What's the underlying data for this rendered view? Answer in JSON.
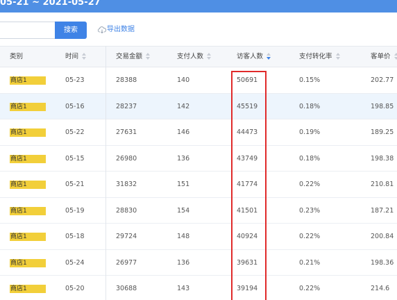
{
  "header": {
    "date_range": "05-21 ~ 2021-05-27"
  },
  "toolbar": {
    "search_value": "",
    "search_label": "搜索",
    "export_label": "导出数据"
  },
  "table": {
    "columns": [
      "类别",
      "时间",
      "交易金额",
      "支付人数",
      "访客人数",
      "支付转化率",
      "客单价"
    ],
    "sorted_column": "访客人数",
    "rows": [
      {
        "category": "商店1",
        "date": "05-23",
        "amount": "28388",
        "payers": "140",
        "visitors": "50691",
        "rate": "0.15%",
        "avg": "202.77"
      },
      {
        "category": "商店1",
        "date": "05-16",
        "amount": "28237",
        "payers": "142",
        "visitors": "45519",
        "rate": "0.18%",
        "avg": "198.85"
      },
      {
        "category": "商店1",
        "date": "05-22",
        "amount": "27631",
        "payers": "146",
        "visitors": "44473",
        "rate": "0.19%",
        "avg": "189.25"
      },
      {
        "category": "商店1",
        "date": "05-15",
        "amount": "26980",
        "payers": "136",
        "visitors": "43749",
        "rate": "0.18%",
        "avg": "198.38"
      },
      {
        "category": "商店1",
        "date": "05-21",
        "amount": "31832",
        "payers": "151",
        "visitors": "41774",
        "rate": "0.22%",
        "avg": "210.81"
      },
      {
        "category": "商店1",
        "date": "05-19",
        "amount": "28830",
        "payers": "154",
        "visitors": "41501",
        "rate": "0.23%",
        "avg": "187.21"
      },
      {
        "category": "商店1",
        "date": "05-18",
        "amount": "29724",
        "payers": "148",
        "visitors": "40924",
        "rate": "0.22%",
        "avg": "200.84"
      },
      {
        "category": "商店1",
        "date": "05-24",
        "amount": "26977",
        "payers": "136",
        "visitors": "39631",
        "rate": "0.21%",
        "avg": "198.36"
      },
      {
        "category": "商店1",
        "date": "05-20",
        "amount": "30688",
        "payers": "143",
        "visitors": "39194",
        "rate": "0.22%",
        "avg": "214.6"
      }
    ]
  },
  "colors": {
    "accent": "#3f83e6",
    "highlight_row": "#edf5fd",
    "category_tag": "#f2cf3a",
    "annotation_box": "#e02a2a"
  },
  "icons": {
    "export": "cloud-download-icon"
  }
}
